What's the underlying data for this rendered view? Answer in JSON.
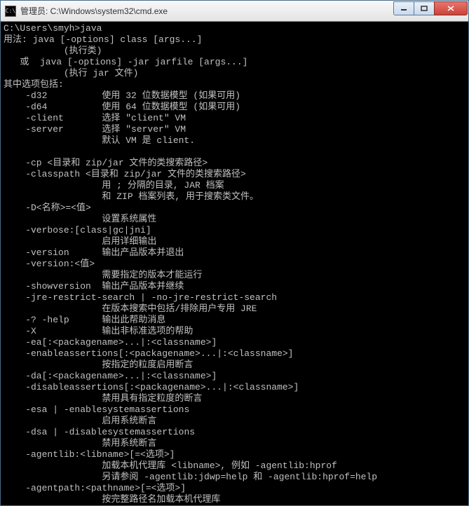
{
  "window": {
    "icon_text": "C:\\",
    "title": "管理员: C:\\Windows\\system32\\cmd.exe"
  },
  "term": {
    "l1": "C:\\Users\\smyh>java",
    "l2": "用法: java [-options] class [args...]",
    "l3": "           (执行类)",
    "l4": "   或  java [-options] -jar jarfile [args...]",
    "l5": "           (执行 jar 文件)",
    "l6": "其中选项包括:",
    "l7": "    -d32          使用 32 位数据模型 (如果可用)",
    "l8": "    -d64          使用 64 位数据模型 (如果可用)",
    "l9": "    -client       选择 \"client\" VM",
    "l10": "    -server       选择 \"server\" VM",
    "l11": "                  默认 VM 是 client.",
    "l12": "",
    "l13": "    -cp <目录和 zip/jar 文件的类搜索路径>",
    "l14": "    -classpath <目录和 zip/jar 文件的类搜索路径>",
    "l15": "                  用 ; 分隔的目录, JAR 档案",
    "l16": "                  和 ZIP 档案列表, 用于搜索类文件。",
    "l17": "    -D<名称>=<值>",
    "l18": "                  设置系统属性",
    "l19": "    -verbose:[class|gc|jni]",
    "l20": "                  启用详细输出",
    "l21": "    -version      输出产品版本并退出",
    "l22": "    -version:<值>",
    "l23": "                  需要指定的版本才能运行",
    "l24": "    -showversion  输出产品版本并继续",
    "l25": "    -jre-restrict-search | -no-jre-restrict-search",
    "l26": "                  在版本搜索中包括/排除用户专用 JRE",
    "l27": "    -? -help      输出此帮助消息",
    "l28": "    -X            输出非标准选项的帮助",
    "l29": "    -ea[:<packagename>...|:<classname>]",
    "l30": "    -enableassertions[:<packagename>...|:<classname>]",
    "l31": "                  按指定的粒度启用断言",
    "l32": "    -da[:<packagename>...|:<classname>]",
    "l33": "    -disableassertions[:<packagename>...|:<classname>]",
    "l34": "                  禁用具有指定粒度的断言",
    "l35": "    -esa | -enablesystemassertions",
    "l36": "                  启用系统断言",
    "l37": "    -dsa | -disablesystemassertions",
    "l38": "                  禁用系统断言",
    "l39": "    -agentlib:<libname>[=<选项>]",
    "l40": "                  加载本机代理库 <libname>, 例如 -agentlib:hprof",
    "l41": "                  另请参阅 -agentlib:jdwp=help 和 -agentlib:hprof=help",
    "l42": "    -agentpath:<pathname>[=<选项>]",
    "l43": "                  按完整路径名加载本机代理库"
  }
}
